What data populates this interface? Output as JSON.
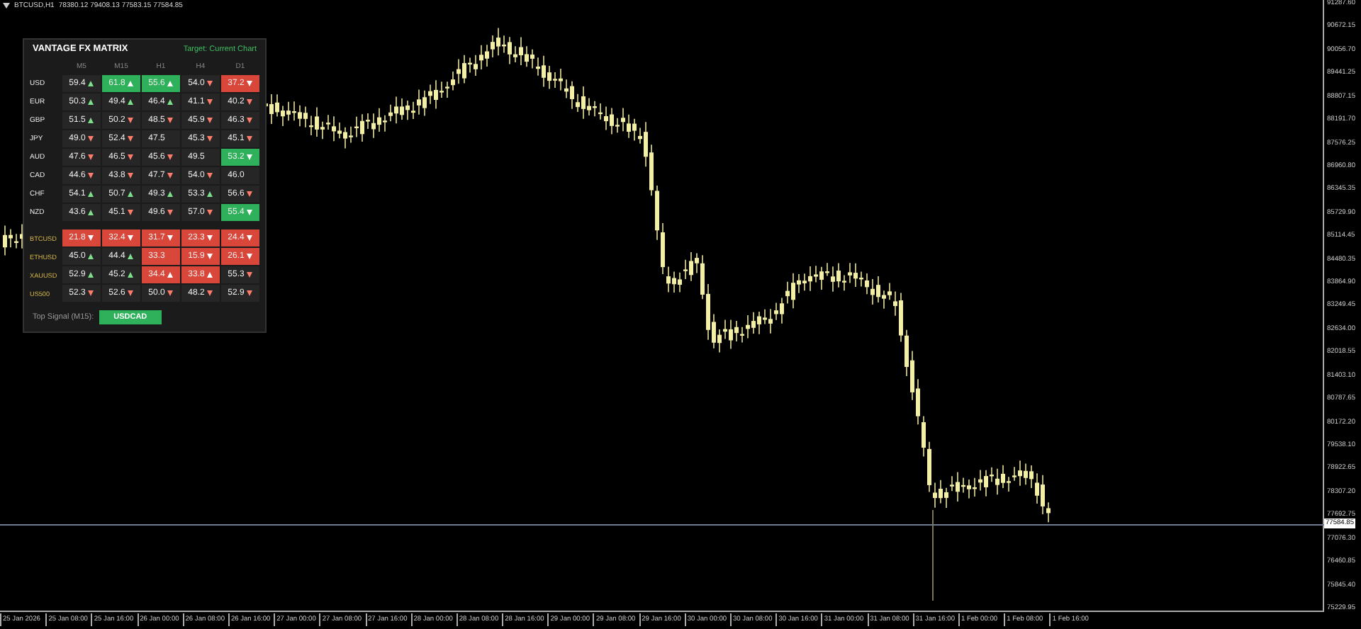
{
  "chart_header": {
    "symbol": "BTCUSD,H1",
    "ohlc": "78380.12 79408.13 77583.15 77584.85"
  },
  "price_axis": {
    "labels": [
      "91287.60",
      "90672.15",
      "90056.70",
      "89441.25",
      "88807.15",
      "88191.70",
      "87576.25",
      "86960.80",
      "86345.35",
      "85729.90",
      "85114.45",
      "84480.35",
      "83864.90",
      "83249.45",
      "82634.00",
      "82018.55",
      "81403.10",
      "80787.65",
      "80172.20",
      "79538.10",
      "78922.65",
      "78307.20",
      "77692.75",
      "77076.30",
      "76460.85",
      "75845.40",
      "75229.95"
    ],
    "current_price": "77584.85"
  },
  "time_axis": {
    "labels": [
      "25 Jan 2026",
      "25 Jan 08:00",
      "25 Jan 16:00",
      "26 Jan 00:00",
      "26 Jan 08:00",
      "26 Jan 16:00",
      "27 Jan 00:00",
      "27 Jan 08:00",
      "27 Jan 16:00",
      "28 Jan 00:00",
      "28 Jan 08:00",
      "28 Jan 16:00",
      "29 Jan 00:00",
      "29 Jan 08:00",
      "29 Jan 16:00",
      "30 Jan 00:00",
      "30 Jan 08:00",
      "30 Jan 16:00",
      "31 Jan 00:00",
      "31 Jan 08:00",
      "31 Jan 16:00",
      "1 Feb 00:00",
      "1 Feb 08:00",
      "1 Feb 16:00"
    ]
  },
  "matrix": {
    "title": "VANTAGE FX MATRIX",
    "target": "Target: Current Chart",
    "columns": [
      "M5",
      "M15",
      "H1",
      "H4",
      "D1"
    ],
    "groups": [
      {
        "kind": "currency",
        "rows": [
          {
            "name": "USD",
            "cells": [
              {
                "value": "59.4",
                "arrow": {
                  "kind": "up",
                  "color": "#7ee08a"
                },
                "color": "#262626"
              },
              {
                "value": "61.8",
                "arrow": {
                  "kind": "up",
                  "color": "#ffffff"
                },
                "color": "#2fb05a"
              },
              {
                "value": "55.6",
                "arrow": {
                  "kind": "up",
                  "color": "#ffffff"
                },
                "color": "#2fb05a"
              },
              {
                "value": "54.0",
                "arrow": {
                  "kind": "down",
                  "color": "#ff7b6b"
                },
                "color": "#262626"
              },
              {
                "value": "37.2",
                "arrow": {
                  "kind": "down",
                  "color": "#ffffff"
                },
                "color": "#d8473a"
              }
            ]
          },
          {
            "name": "EUR",
            "cells": [
              {
                "value": "50.3",
                "arrow": {
                  "kind": "up",
                  "color": "#7ee08a"
                },
                "color": "#262626"
              },
              {
                "value": "49.4",
                "arrow": {
                  "kind": "up",
                  "color": "#7ee08a"
                },
                "color": "#262626"
              },
              {
                "value": "46.4",
                "arrow": {
                  "kind": "up",
                  "color": "#7ee08a"
                },
                "color": "#262626"
              },
              {
                "value": "41.1",
                "arrow": {
                  "kind": "down",
                  "color": "#ff7b6b"
                },
                "color": "#262626"
              },
              {
                "value": "40.2",
                "arrow": {
                  "kind": "down",
                  "color": "#ff7b6b"
                },
                "color": "#262626"
              }
            ]
          },
          {
            "name": "GBP",
            "cells": [
              {
                "value": "51.5",
                "arrow": {
                  "kind": "up",
                  "color": "#7ee08a"
                },
                "color": "#262626"
              },
              {
                "value": "50.2",
                "arrow": {
                  "kind": "down",
                  "color": "#ff7b6b"
                },
                "color": "#262626"
              },
              {
                "value": "48.5",
                "arrow": {
                  "kind": "down",
                  "color": "#ff7b6b"
                },
                "color": "#262626"
              },
              {
                "value": "45.9",
                "arrow": {
                  "kind": "down",
                  "color": "#ff7b6b"
                },
                "color": "#262626"
              },
              {
                "value": "46.3",
                "arrow": {
                  "kind": "down",
                  "color": "#ff7b6b"
                },
                "color": "#262626"
              }
            ]
          },
          {
            "name": "JPY",
            "cells": [
              {
                "value": "49.0",
                "arrow": {
                  "kind": "down",
                  "color": "#ff7b6b"
                },
                "color": "#262626"
              },
              {
                "value": "52.4",
                "arrow": {
                  "kind": "down",
                  "color": "#ff7b6b"
                },
                "color": "#262626"
              },
              {
                "value": "47.5",
                "color": "#262626"
              },
              {
                "value": "45.3",
                "arrow": {
                  "kind": "down",
                  "color": "#ff7b6b"
                },
                "color": "#262626"
              },
              {
                "value": "45.1",
                "arrow": {
                  "kind": "down",
                  "color": "#ff7b6b"
                },
                "color": "#262626"
              }
            ]
          },
          {
            "name": "AUD",
            "cells": [
              {
                "value": "47.6",
                "arrow": {
                  "kind": "down",
                  "color": "#ff7b6b"
                },
                "color": "#262626"
              },
              {
                "value": "46.5",
                "arrow": {
                  "kind": "down",
                  "color": "#ff7b6b"
                },
                "color": "#262626"
              },
              {
                "value": "45.6",
                "arrow": {
                  "kind": "down",
                  "color": "#ff7b6b"
                },
                "color": "#262626"
              },
              {
                "value": "49.5",
                "color": "#262626"
              },
              {
                "value": "53.2",
                "arrow": {
                  "kind": "down",
                  "color": "#ffffff"
                },
                "color": "#2fb05a"
              }
            ]
          },
          {
            "name": "CAD",
            "cells": [
              {
                "value": "44.6",
                "arrow": {
                  "kind": "down",
                  "color": "#ff7b6b"
                },
                "color": "#262626"
              },
              {
                "value": "43.8",
                "arrow": {
                  "kind": "down",
                  "color": "#ff7b6b"
                },
                "color": "#262626"
              },
              {
                "value": "47.7",
                "arrow": {
                  "kind": "down",
                  "color": "#ff7b6b"
                },
                "color": "#262626"
              },
              {
                "value": "54.0",
                "arrow": {
                  "kind": "down",
                  "color": "#ff7b6b"
                },
                "color": "#262626"
              },
              {
                "value": "46.0",
                "color": "#262626"
              }
            ]
          },
          {
            "name": "CHF",
            "cells": [
              {
                "value": "54.1",
                "arrow": {
                  "kind": "up",
                  "color": "#7ee08a"
                },
                "color": "#262626"
              },
              {
                "value": "50.7",
                "arrow": {
                  "kind": "up",
                  "color": "#7ee08a"
                },
                "color": "#262626"
              },
              {
                "value": "49.3",
                "arrow": {
                  "kind": "up",
                  "color": "#7ee08a"
                },
                "color": "#262626"
              },
              {
                "value": "53.3",
                "arrow": {
                  "kind": "up",
                  "color": "#7ee08a"
                },
                "color": "#262626"
              },
              {
                "value": "56.6",
                "arrow": {
                  "kind": "down",
                  "color": "#ff7b6b"
                },
                "color": "#262626"
              }
            ]
          },
          {
            "name": "NZD",
            "cells": [
              {
                "value": "43.6",
                "arrow": {
                  "kind": "up",
                  "color": "#7ee08a"
                },
                "color": "#262626"
              },
              {
                "value": "45.1",
                "arrow": {
                  "kind": "down",
                  "color": "#ff7b6b"
                },
                "color": "#262626"
              },
              {
                "value": "49.6",
                "arrow": {
                  "kind": "down",
                  "color": "#ff7b6b"
                },
                "color": "#262626"
              },
              {
                "value": "57.0",
                "arrow": {
                  "kind": "down",
                  "color": "#ff7b6b"
                },
                "color": "#262626"
              },
              {
                "value": "55.4",
                "arrow": {
                  "kind": "down",
                  "color": "#ffffff"
                },
                "color": "#2fb05a"
              }
            ]
          }
        ]
      },
      {
        "kind": "asset",
        "rows": [
          {
            "name": "BTCUSD",
            "cells": [
              {
                "value": "21.8",
                "arrow": {
                  "kind": "down",
                  "color": "#ffffff"
                },
                "color": "#d8473a"
              },
              {
                "value": "32.4",
                "arrow": {
                  "kind": "down",
                  "color": "#ffffff"
                },
                "color": "#d8473a"
              },
              {
                "value": "31.7",
                "arrow": {
                  "kind": "down",
                  "color": "#ffffff"
                },
                "color": "#d8473a"
              },
              {
                "value": "23.3",
                "arrow": {
                  "kind": "down",
                  "color": "#ffffff"
                },
                "color": "#d8473a"
              },
              {
                "value": "24.4",
                "arrow": {
                  "kind": "down",
                  "color": "#ffffff"
                },
                "color": "#d8473a"
              }
            ]
          },
          {
            "name": "ETHUSD",
            "cells": [
              {
                "value": "45.0",
                "arrow": {
                  "kind": "up",
                  "color": "#7ee08a"
                },
                "color": "#262626"
              },
              {
                "value": "44.4",
                "arrow": {
                  "kind": "up",
                  "color": "#7ee08a"
                },
                "color": "#262626"
              },
              {
                "value": "33.3",
                "color": "#d8473a"
              },
              {
                "value": "15.9",
                "arrow": {
                  "kind": "down",
                  "color": "#ffffff"
                },
                "color": "#d8473a"
              },
              {
                "value": "26.1",
                "arrow": {
                  "kind": "down",
                  "color": "#ffffff"
                },
                "color": "#d8473a"
              }
            ]
          },
          {
            "name": "XAUUSD",
            "cells": [
              {
                "value": "52.9",
                "arrow": {
                  "kind": "up",
                  "color": "#7ee08a"
                },
                "color": "#262626"
              },
              {
                "value": "45.2",
                "arrow": {
                  "kind": "up",
                  "color": "#7ee08a"
                },
                "color": "#262626"
              },
              {
                "value": "34.4",
                "arrow": {
                  "kind": "up",
                  "color": "#ffffff"
                },
                "color": "#d8473a"
              },
              {
                "value": "33.8",
                "arrow": {
                  "kind": "up",
                  "color": "#ffffff"
                },
                "color": "#d8473a"
              },
              {
                "value": "55.3",
                "arrow": {
                  "kind": "down",
                  "color": "#ff7b6b"
                },
                "color": "#262626"
              }
            ]
          },
          {
            "name": "US500",
            "cells": [
              {
                "value": "52.3",
                "arrow": {
                  "kind": "down",
                  "color": "#ff7b6b"
                },
                "color": "#262626"
              },
              {
                "value": "52.6",
                "arrow": {
                  "kind": "down",
                  "color": "#ff7b6b"
                },
                "color": "#262626"
              },
              {
                "value": "50.0",
                "arrow": {
                  "kind": "down",
                  "color": "#ff7b6b"
                },
                "color": "#262626"
              },
              {
                "value": "48.2",
                "arrow": {
                  "kind": "down",
                  "color": "#ff7b6b"
                },
                "color": "#262626"
              },
              {
                "value": "52.9",
                "arrow": {
                  "kind": "down",
                  "color": "#ff7b6b"
                },
                "color": "#262626"
              }
            ]
          }
        ]
      }
    ],
    "top_signal": {
      "label": "Top Signal (M15):",
      "value": "USDCAD"
    }
  }
}
